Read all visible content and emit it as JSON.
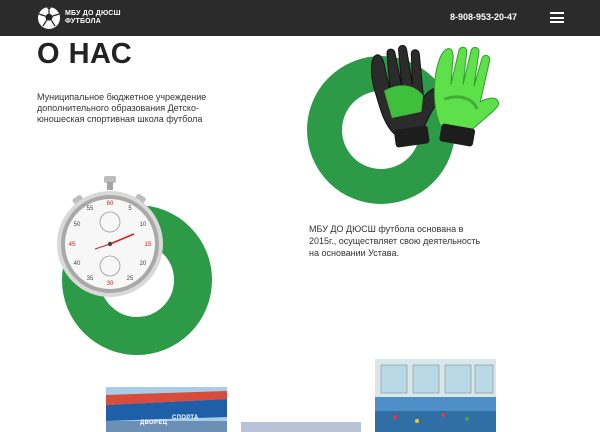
{
  "header": {
    "brand_line1": "МБУ ДО ДЮСШ",
    "brand_line2": "ФУТБОЛА",
    "phone": "8-908-953-20-47",
    "logo_icon": "soccer-ball-icon",
    "menu_icon": "hamburger-menu-icon"
  },
  "main": {
    "title": "О НАС",
    "intro": "Муниципальное бюджетное учреждение дополнительного образования Детско-юношеская спортивная школа футбола",
    "founding": "МБУ ДО ДЮСШ футбола основана в 2015г., осуществляет свою деятельность на основании Устава."
  },
  "stopwatch": {
    "dial_numbers": [
      "60",
      "5",
      "10",
      "15",
      "20",
      "25",
      "30",
      "35",
      "40",
      "45",
      "50",
      "55"
    ]
  },
  "photos": {
    "photo1_text1": "ДВОРЕЦ",
    "photo1_text2": "СПОРТА"
  },
  "colors": {
    "accent": "#2c9a47",
    "header_bg": "#2b2b2b"
  }
}
